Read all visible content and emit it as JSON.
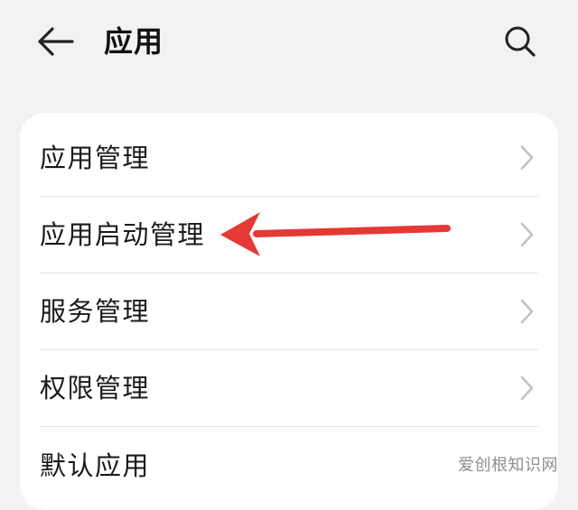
{
  "header": {
    "title": "应用",
    "back_icon": "arrow-left-icon",
    "search_icon": "search-icon"
  },
  "settings": {
    "items": [
      {
        "label": "应用管理"
      },
      {
        "label": "应用启动管理"
      },
      {
        "label": "服务管理"
      },
      {
        "label": "权限管理"
      },
      {
        "label": "默认应用"
      }
    ]
  },
  "annotation": {
    "icon": "red-arrow-icon",
    "color": "#e53935"
  },
  "watermark": {
    "text": "爱创根知识网"
  },
  "colors": {
    "background": "#f1f2f4",
    "card": "#ffffff",
    "text": "#1a1a1a",
    "chevron": "#c2c2c2"
  }
}
